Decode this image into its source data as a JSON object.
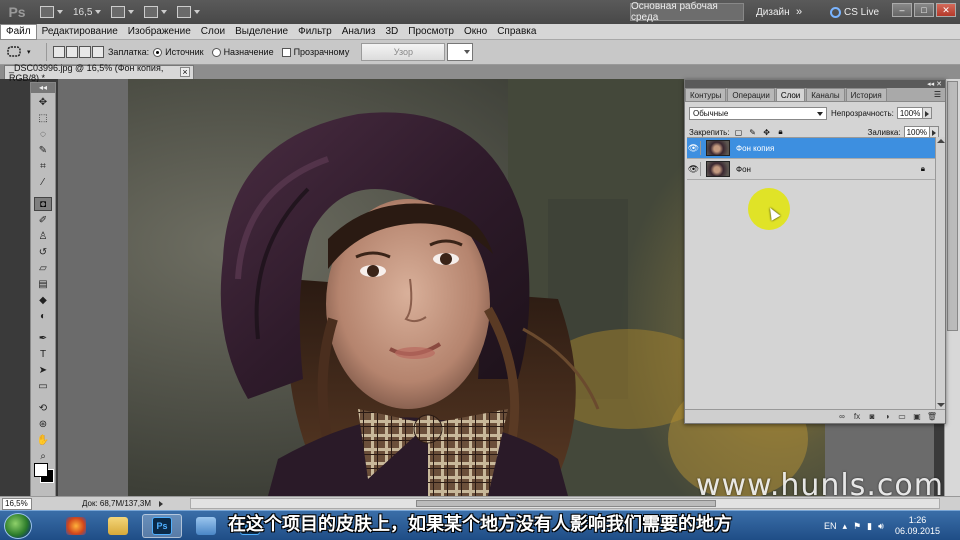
{
  "app": {
    "logo": "Ps",
    "zoom": "16,5",
    "workspace_active": "Основная рабочая среда",
    "workspace_other": "Дизайн",
    "workspace_more": "»",
    "cs_live": "CS Live",
    "window_min": "–",
    "window_max": "□",
    "window_close": "✕"
  },
  "menu": {
    "items": [
      "Файл",
      "Редактирование",
      "Изображение",
      "Слои",
      "Выделение",
      "Фильтр",
      "Анализ",
      "3D",
      "Просмотр",
      "Окно",
      "Справка"
    ]
  },
  "options_bar": {
    "patch_label": "Заплатка:",
    "source_label": "Источник",
    "destination_label": "Назначение",
    "transparent_label": "Прозрачному",
    "pattern_button": "Узор"
  },
  "document": {
    "tab_title": "_DSC03996.jpg @ 16,5% (Фон копия, RGB/8) *",
    "tab_close": "×"
  },
  "status": {
    "zoom": "16,5%",
    "doc_info": "Док: 68,7M/137,3M"
  },
  "panel": {
    "tabs": [
      "Контуры",
      "Операции",
      "Слои",
      "Каналы",
      "История"
    ],
    "blend_mode": "Обычные",
    "opacity_label": "Непрозрачность:",
    "opacity_value": "100%",
    "lock_label": "Закрепить:",
    "fill_label": "Заливка:",
    "fill_value": "100%",
    "layers": [
      {
        "name": "Фон копия",
        "selected": true
      },
      {
        "name": "Фон",
        "selected": false
      }
    ]
  },
  "watermark": "www.hunls.com",
  "subtitle": "在这个项目的皮肤上，如果某个地方没有人影响我们需要的地方",
  "taskbar": {
    "tasks": [
      "firefox",
      "explorer",
      "photoshop",
      "explorer-window",
      "photoshop-2"
    ],
    "ps_label": "Ps",
    "language": "EN",
    "time": "1:26",
    "date": "06.09.2015"
  }
}
